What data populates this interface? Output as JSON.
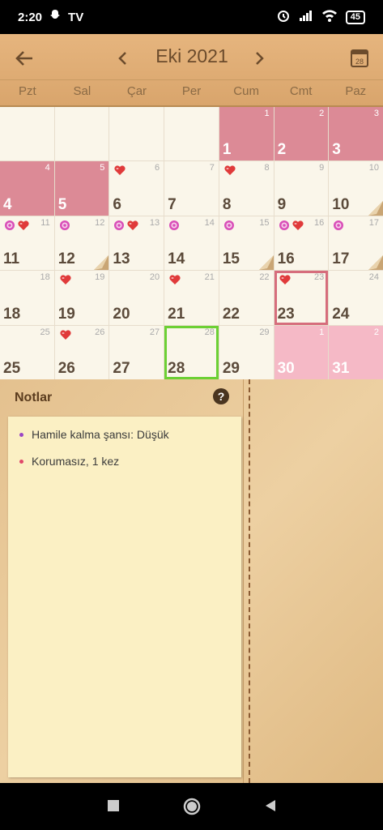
{
  "status": {
    "time": "2:20",
    "tv": "TV",
    "battery": "45"
  },
  "header": {
    "month_title": "Eki 2021",
    "calendar_icon_day": "28",
    "weekdays": [
      "Pzt",
      "Sal",
      "Çar",
      "Per",
      "Cum",
      "Cmt",
      "Paz"
    ]
  },
  "calendar": {
    "cells": [
      {
        "corner": "",
        "num": "",
        "state": "blank"
      },
      {
        "corner": "",
        "num": "",
        "state": "blank"
      },
      {
        "corner": "",
        "num": "",
        "state": "blank"
      },
      {
        "corner": "",
        "num": "",
        "state": "blank"
      },
      {
        "corner": "1",
        "num": "1",
        "state": "period"
      },
      {
        "corner": "2",
        "num": "2",
        "state": "period"
      },
      {
        "corner": "3",
        "num": "3",
        "state": "period"
      },
      {
        "corner": "4",
        "num": "4",
        "state": "period"
      },
      {
        "corner": "5",
        "num": "5",
        "state": "period"
      },
      {
        "corner": "6",
        "num": "6",
        "icons": [
          "heart"
        ]
      },
      {
        "corner": "7",
        "num": "7"
      },
      {
        "corner": "8",
        "num": "8",
        "icons": [
          "heart"
        ]
      },
      {
        "corner": "9",
        "num": "9"
      },
      {
        "corner": "10",
        "num": "10",
        "fold": true
      },
      {
        "corner": "11",
        "num": "11",
        "icons": [
          "flower",
          "heart"
        ]
      },
      {
        "corner": "12",
        "num": "12",
        "icons": [
          "flower"
        ],
        "fold": true
      },
      {
        "corner": "13",
        "num": "13",
        "icons": [
          "flower",
          "heart"
        ]
      },
      {
        "corner": "14",
        "num": "14",
        "icons": [
          "flower"
        ]
      },
      {
        "corner": "15",
        "num": "15",
        "icons": [
          "flower"
        ],
        "fold": true
      },
      {
        "corner": "16",
        "num": "16",
        "icons": [
          "flower",
          "heart"
        ]
      },
      {
        "corner": "17",
        "num": "17",
        "icons": [
          "flower"
        ],
        "fold": true
      },
      {
        "corner": "18",
        "num": "18"
      },
      {
        "corner": "19",
        "num": "19",
        "icons": [
          "heart"
        ]
      },
      {
        "corner": "20",
        "num": "20"
      },
      {
        "corner": "21",
        "num": "21",
        "icons": [
          "heart"
        ]
      },
      {
        "corner": "22",
        "num": "22"
      },
      {
        "corner": "23",
        "num": "23",
        "icons": [
          "heart"
        ],
        "state": "selected"
      },
      {
        "corner": "24",
        "num": "24"
      },
      {
        "corner": "25",
        "num": "25"
      },
      {
        "corner": "26",
        "num": "26",
        "icons": [
          "heart"
        ]
      },
      {
        "corner": "27",
        "num": "27"
      },
      {
        "corner": "28",
        "num": "28",
        "state": "today"
      },
      {
        "corner": "29",
        "num": "29"
      },
      {
        "corner": "1",
        "num": "30",
        "state": "future-period"
      },
      {
        "corner": "2",
        "num": "31",
        "state": "future-period"
      }
    ]
  },
  "notes": {
    "title": "Notlar",
    "items": [
      {
        "text": "Hamile kalma şansı: Düşük",
        "dot_color": "#9b46c4"
      },
      {
        "text": "Korumasız, 1 kez",
        "dot_color": "#e0476a"
      }
    ]
  },
  "colors": {
    "period": "#dc8a96",
    "future_period": "#f5b9c6",
    "today_border": "#6cd034",
    "selected_border": "#d66d7c"
  },
  "icons": [
    "back-arrow-icon",
    "chevron-left-icon",
    "chevron-right-icon",
    "calendar-icon",
    "help-icon",
    "heart-icon",
    "flower-icon"
  ]
}
